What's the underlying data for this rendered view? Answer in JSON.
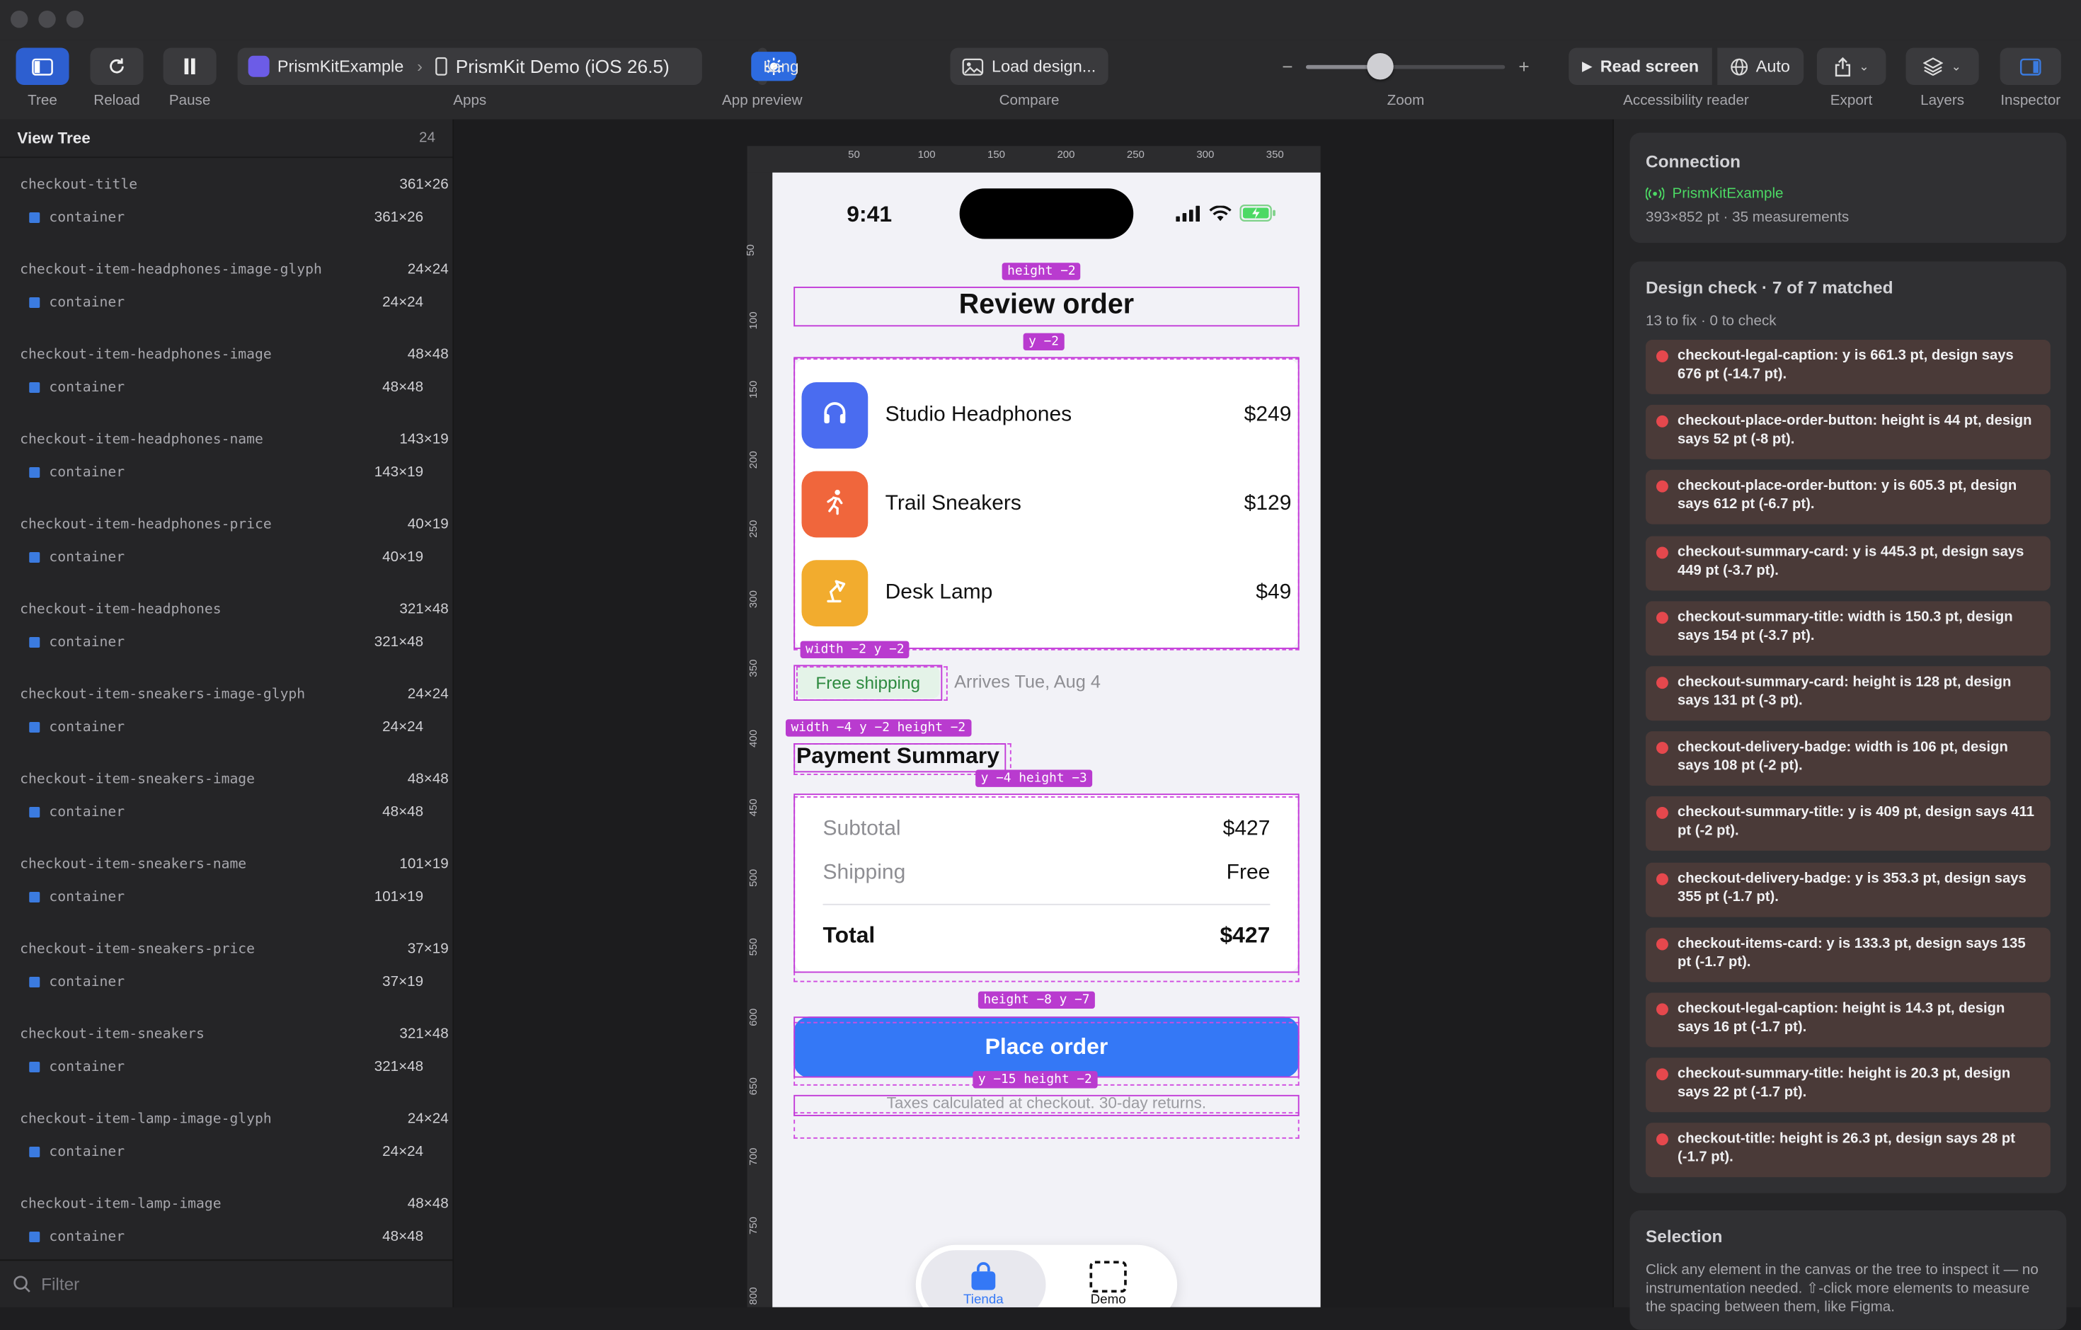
{
  "toolbar": {
    "tree": "Tree",
    "reload": "Reload",
    "pause": "Pause",
    "app_name": "PrismKitExample",
    "device": "PrismKit Demo (iOS 26.5)",
    "apps_label": "Apps",
    "lang": "Lang",
    "app_preview_label": "App preview",
    "load_design": "Load design...",
    "compare_label": "Compare",
    "zoom_minus": "−",
    "zoom_plus": "+",
    "zoom_label": "Zoom",
    "zoom_level": 0.35,
    "read_screen": "Read screen",
    "auto": "Auto",
    "accessibility_label": "Accessibility reader",
    "export_label": "Export",
    "layers_label": "Layers",
    "inspector_label": "Inspector"
  },
  "left": {
    "title": "View Tree",
    "count": "24",
    "filter_placeholder": "Filter",
    "nodes": [
      {
        "name": "checkout-title",
        "size": "361×26",
        "child": "container",
        "child_size": "361×26"
      },
      {
        "name": "checkout-item-headphones-image-glyph",
        "size": "24×24",
        "child": "container",
        "child_size": "24×24"
      },
      {
        "name": "checkout-item-headphones-image",
        "size": "48×48",
        "child": "container",
        "child_size": "48×48"
      },
      {
        "name": "checkout-item-headphones-name",
        "size": "143×19",
        "child": "container",
        "child_size": "143×19"
      },
      {
        "name": "checkout-item-headphones-price",
        "size": "40×19",
        "child": "container",
        "child_size": "40×19"
      },
      {
        "name": "checkout-item-headphones",
        "size": "321×48",
        "child": "container",
        "child_size": "321×48"
      },
      {
        "name": "checkout-item-sneakers-image-glyph",
        "size": "24×24",
        "child": "container",
        "child_size": "24×24"
      },
      {
        "name": "checkout-item-sneakers-image",
        "size": "48×48",
        "child": "container",
        "child_size": "48×48"
      },
      {
        "name": "checkout-item-sneakers-name",
        "size": "101×19",
        "child": "container",
        "child_size": "101×19"
      },
      {
        "name": "checkout-item-sneakers-price",
        "size": "37×19",
        "child": "container",
        "child_size": "37×19"
      },
      {
        "name": "checkout-item-sneakers",
        "size": "321×48",
        "child": "container",
        "child_size": "321×48"
      },
      {
        "name": "checkout-item-lamp-image-glyph",
        "size": "24×24",
        "child": "container",
        "child_size": "24×24"
      },
      {
        "name": "checkout-item-lamp-image",
        "size": "48×48",
        "child": "container",
        "child_size": "48×48"
      }
    ]
  },
  "canvas": {
    "ruler_top": [
      "50",
      "100",
      "150",
      "200",
      "250",
      "300",
      "350"
    ],
    "ruler_left": [
      "50",
      "100",
      "150",
      "200",
      "250",
      "300",
      "350",
      "400",
      "450",
      "500",
      "550",
      "600",
      "650",
      "700",
      "750",
      "800"
    ],
    "tags": {
      "title": "height −2",
      "items": "y −2",
      "badge": "width −2  y −2",
      "sum_title": "width −4  y −2  height −2",
      "sum_card": "y −4  height −3",
      "button": "height −8  y −7",
      "legal": "y −15  height −2"
    }
  },
  "phone": {
    "time": "9:41",
    "title": "Review order",
    "items": [
      {
        "name": "Studio Headphones",
        "price": "$249",
        "color": "#4a6cf0",
        "icon": "headphones-icon"
      },
      {
        "name": "Trail Sneakers",
        "price": "$129",
        "color": "#f0663c",
        "icon": "running-figure-icon"
      },
      {
        "name": "Desk Lamp",
        "price": "$49",
        "color": "#f2ac2e",
        "icon": "desk-lamp-icon"
      }
    ],
    "badge": "Free shipping",
    "arrives": "Arrives Tue, Aug 4",
    "summary_title": "Payment Summary",
    "subtotal_label": "Subtotal",
    "subtotal_value": "$427",
    "shipping_label": "Shipping",
    "shipping_value": "Free",
    "total_label": "Total",
    "total_value": "$427",
    "button": "Place order",
    "legal": "Taxes calculated at checkout. 30-day returns.",
    "tabs": [
      "Tienda",
      "Demo"
    ]
  },
  "right": {
    "connection_title": "Connection",
    "connection_app": "PrismKitExample",
    "connection_meta": "393×852 pt · 35 measurements",
    "design_title": "Design check · 7 of 7 matched",
    "design_sub": "13 to fix · 0 to check",
    "issues": [
      "checkout-legal-caption: y is 661.3 pt, design says 676 pt (-14.7 pt).",
      "checkout-place-order-button: height is 44 pt, design says 52 pt (-8 pt).",
      "checkout-place-order-button: y is 605.3 pt, design says 612 pt (-6.7 pt).",
      "checkout-summary-card: y is 445.3 pt, design says 449 pt (-3.7 pt).",
      "checkout-summary-title: width is 150.3 pt, design says 154 pt (-3.7 pt).",
      "checkout-summary-card: height is 128 pt, design says 131 pt (-3 pt).",
      "checkout-delivery-badge: width is 106 pt, design says 108 pt (-2 pt).",
      "checkout-summary-title: y is 409 pt, design says 411 pt (-2 pt).",
      "checkout-delivery-badge: y is 353.3 pt, design says 355 pt (-1.7 pt).",
      "checkout-items-card: y is 133.3 pt, design says 135 pt (-1.7 pt).",
      "checkout-legal-caption: height is 14.3 pt, design says 16 pt (-1.7 pt).",
      "checkout-summary-title: height is 20.3 pt, design says 22 pt (-1.7 pt).",
      "checkout-title: height is 26.3 pt, design says 28 pt (-1.7 pt)."
    ],
    "selection_title": "Selection",
    "selection_text": "Click any element in the canvas or the tree to inspect it — no instrumentation needed. ⇧-click more elements to measure the spacing between them, like Figma."
  },
  "colors": {
    "accent": "#3478f6",
    "annotation": "#c23ad8",
    "error": "#e5484d",
    "connected": "#4cd964"
  }
}
